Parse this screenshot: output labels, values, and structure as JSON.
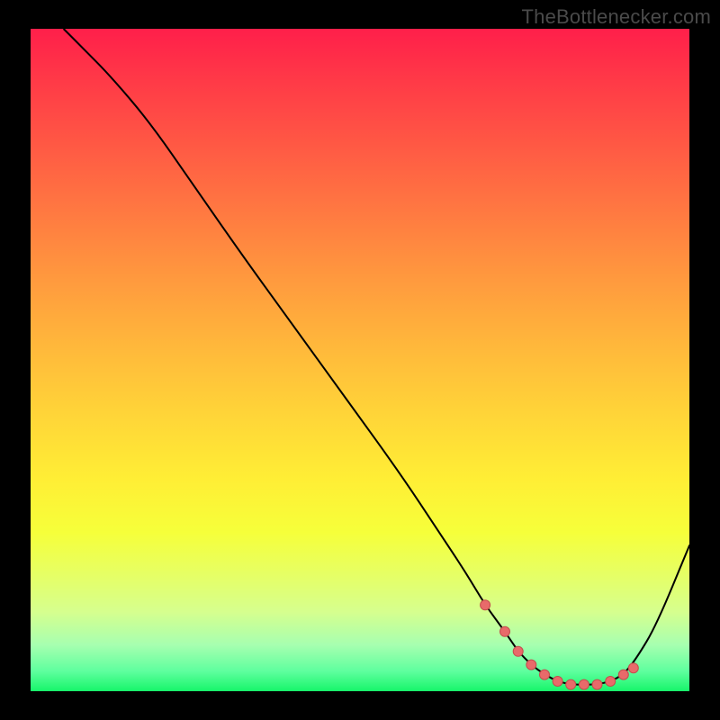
{
  "watermark": "TheBottlenecker.com",
  "colors": {
    "curve_stroke": "#000000",
    "marker_fill": "#e86a6a",
    "marker_stroke": "#c44d4d"
  },
  "chart_data": {
    "type": "line",
    "title": "",
    "xlabel": "",
    "ylabel": "",
    "xlim": [
      0,
      100
    ],
    "ylim": [
      0,
      100
    ],
    "x": [
      5,
      8,
      12,
      18,
      25,
      32,
      40,
      48,
      56,
      62,
      66,
      69,
      72,
      74,
      76,
      78,
      80,
      82,
      84,
      86,
      88,
      90,
      92,
      95,
      100
    ],
    "y": [
      100,
      97,
      93,
      86,
      76,
      66,
      55,
      44,
      33,
      24,
      18,
      13,
      9,
      6,
      4,
      2.5,
      1.5,
      1,
      1,
      1,
      1.5,
      2.5,
      5,
      10,
      22
    ],
    "floor_markers_x": [
      69,
      72,
      74,
      76,
      78,
      80,
      82,
      84,
      86,
      88,
      90,
      91.5
    ],
    "floor_markers_y": [
      13,
      9,
      6,
      4,
      2.5,
      1.5,
      1,
      1,
      1,
      1.5,
      2.5,
      3.5
    ]
  }
}
